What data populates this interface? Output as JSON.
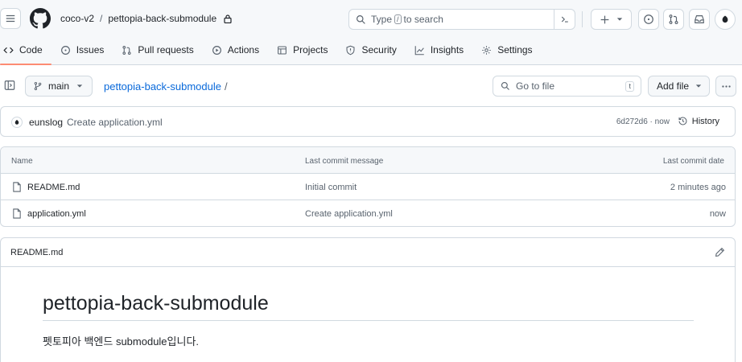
{
  "header": {
    "owner": "coco-v2",
    "repo": "pettopia-back-submodule",
    "search_placeholder_before": "Type",
    "search_key": "/",
    "search_placeholder_after": "to search"
  },
  "tabs": [
    {
      "label": "Code",
      "icon": "code-icon",
      "active": true
    },
    {
      "label": "Issues",
      "icon": "issue-icon"
    },
    {
      "label": "Pull requests",
      "icon": "pull-request-icon"
    },
    {
      "label": "Actions",
      "icon": "play-icon"
    },
    {
      "label": "Projects",
      "icon": "table-icon"
    },
    {
      "label": "Security",
      "icon": "shield-icon"
    },
    {
      "label": "Insights",
      "icon": "graph-icon"
    },
    {
      "label": "Settings",
      "icon": "gear-icon"
    }
  ],
  "toolbar": {
    "branch": "main",
    "path_repo": "pettopia-back-submodule",
    "path_sep": "/",
    "goto_placeholder": "Go to file",
    "goto_key": "t",
    "add_file": "Add file"
  },
  "commit": {
    "author": "eunslog",
    "message": "Create application.yml",
    "sha_time": "6d272d6 · now",
    "history": "History"
  },
  "files": {
    "headers": {
      "name": "Name",
      "message": "Last commit message",
      "date": "Last commit date"
    },
    "rows": [
      {
        "name": "README.md",
        "message": "Initial commit",
        "date": "2 minutes ago"
      },
      {
        "name": "application.yml",
        "message": "Create application.yml",
        "date": "now"
      }
    ]
  },
  "readme": {
    "file": "README.md",
    "heading": "pettopia-back-submodule",
    "body": "펫토피아 백엔드 submodule입니다."
  }
}
